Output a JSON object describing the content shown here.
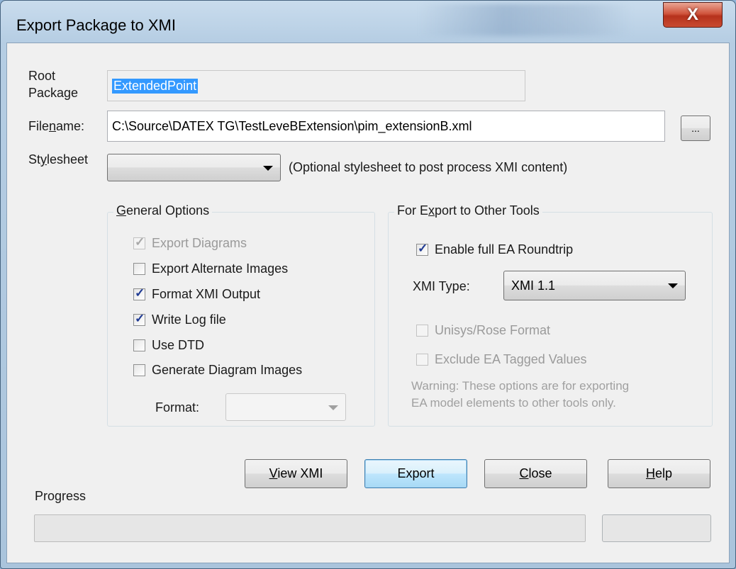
{
  "window": {
    "title": "Export Package to XMI",
    "close_glyph": "X"
  },
  "fields": {
    "root_package_label": "Root\nPackage",
    "root_package_value": "ExtendedPoint",
    "filename_label_pre": "File",
    "filename_label_u": "n",
    "filename_label_post": "ame:",
    "filename_value": "C:\\Source\\DATEX TG\\TestLeveBExtension\\pim_extensionB.xml",
    "browse_label": "...",
    "stylesheet_label_pre": "St",
    "stylesheet_label_u": "y",
    "stylesheet_label_post": "lesheet",
    "stylesheet_value": "",
    "stylesheet_hint": "(Optional stylesheet to post process XMI content)"
  },
  "general_options": {
    "title_u": "G",
    "title_rest": "eneral Options",
    "items": [
      {
        "label": "Export Diagrams",
        "checked": true,
        "disabled": true
      },
      {
        "label": "Export Alternate Images",
        "checked": false,
        "disabled": false
      },
      {
        "label": "Format XMI Output",
        "checked": true,
        "disabled": false
      },
      {
        "label": "Write Log file",
        "checked": true,
        "disabled": false
      },
      {
        "label": "Use DTD",
        "checked": false,
        "disabled": false
      },
      {
        "label": "Generate Diagram Images",
        "checked": false,
        "disabled": false
      }
    ],
    "format_label": "Format:",
    "format_value": ""
  },
  "other_tools": {
    "title_pre": "For E",
    "title_u": "x",
    "title_post": "port to Other Tools",
    "roundtrip_label": "Enable full EA Roundtrip",
    "roundtrip_checked": true,
    "xmi_type_label": "XMI Type:",
    "xmi_type_value": "XMI 1.1",
    "unisys_label": "Unisys/Rose Format",
    "exclude_label": "Exclude EA Tagged Values",
    "warning_line1": "Warning: These options are for exporting",
    "warning_line2": "EA model elements to other tools only."
  },
  "buttons": {
    "view_xmi_u": "V",
    "view_xmi_rest": "iew XMI",
    "export": "Export",
    "close_u": "C",
    "close_rest": "lose",
    "help_u": "H",
    "help_rest": "elp"
  },
  "progress": {
    "label": "Progress",
    "value": 0
  },
  "colors": {
    "selection": "#3399ff",
    "close_button": "#c84a30",
    "title_gradient": "#b5cde3"
  }
}
